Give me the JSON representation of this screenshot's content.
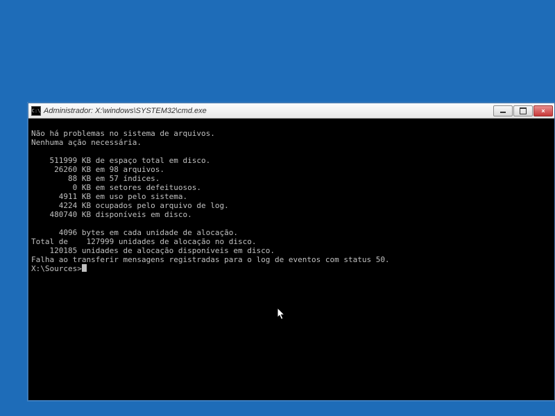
{
  "window": {
    "title": "Administrador: X:\\windows\\SYSTEM32\\cmd.exe",
    "icon_label": "C:\\"
  },
  "terminal": {
    "lines": [
      "",
      "Não há problemas no sistema de arquivos.",
      "Nenhuma ação necessária.",
      "",
      "    511999 KB de espaço total em disco.",
      "     26260 KB em 98 arquivos.",
      "        88 KB em 57 índices.",
      "         0 KB em setores defeituosos.",
      "      4911 KB em uso pelo sistema.",
      "      4224 KB ocupados pelo arquivo de log.",
      "    480740 KB disponíveis em disco.",
      "",
      "      4096 bytes em cada unidade de alocação.",
      "Total de    127999 unidades de alocação no disco.",
      "    120185 unidades de alocação disponíveis em disco.",
      "Falha ao transferir mensagens registradas para o log de eventos com status 50.",
      ""
    ],
    "prompt": "X:\\Sources>"
  }
}
